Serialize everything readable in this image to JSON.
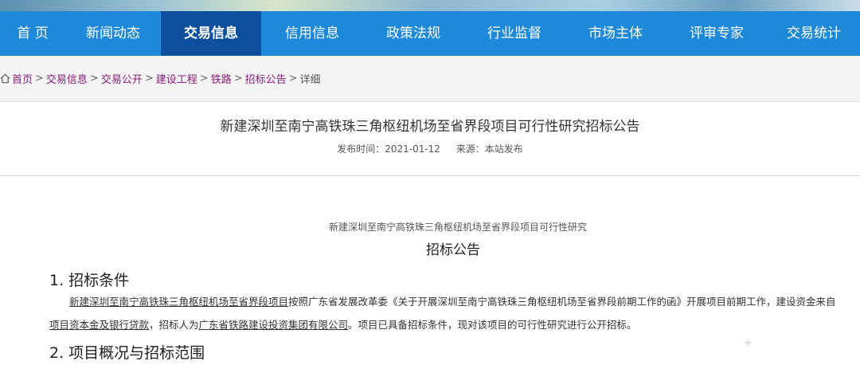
{
  "nav": {
    "items": [
      "首 页",
      "新闻动态",
      "交易信息",
      "信用信息",
      "政策法规",
      "行业监督",
      "市场主体",
      "评审专家",
      "交易统计"
    ],
    "active_index": 2
  },
  "breadcrumb": {
    "items": [
      "首页",
      "交易信息",
      "交易公开",
      "建设工程",
      "铁路",
      "招标公告"
    ],
    "current": "详细",
    "separator": ">"
  },
  "header": {
    "title": "新建深圳至南宁高铁珠三角枢纽机场至省界段项目可行性研究招标公告",
    "publish_time_label": "发布时间：2021-01-12",
    "source_label": "来源：本站发布"
  },
  "document": {
    "subtitle": "新建深圳至南宁高铁珠三角枢纽机场至省界段项目可行性研究",
    "title": "招标公告",
    "section1": {
      "heading": "1. 招标条件",
      "line1": {
        "project_link": "新建深圳至南宁高铁珠三角枢纽机场至省界段项目",
        "text": "按照广东省发展改革委《关于开展深圳至南宁高铁珠三角枢纽机场至省界段前期工作的函》开展项目前期工作，建设资金来自"
      },
      "line2": {
        "funding_link": "项目资本金及银行贷款",
        "text_a": "，招标人为",
        "tenderer_link": "广东省铁路建设投资集团有限公司",
        "text_b": "。项目已具备招标条件，现对该项目的可行性研究进行公开招标。"
      }
    },
    "section2": {
      "heading": "2. 项目概况与招标范围"
    }
  },
  "colors": {
    "nav_bg": "#1e88d9",
    "nav_active_bg": "#0c4f9c",
    "breadcrumb_link": "#8a1a7a"
  }
}
